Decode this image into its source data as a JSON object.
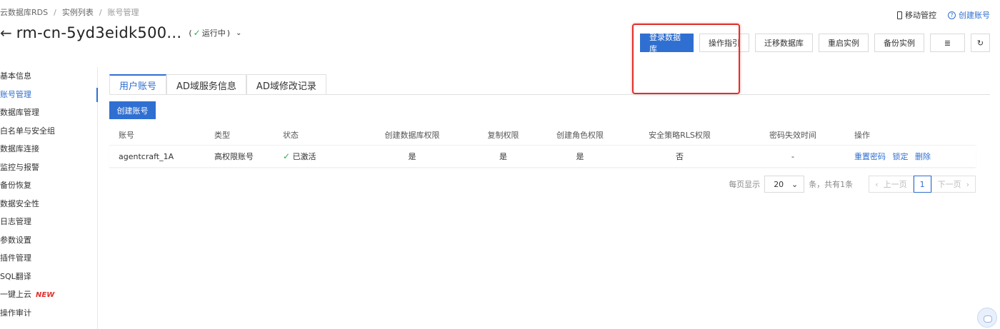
{
  "breadcrumb": {
    "items": [
      "云数据库RDS",
      "实例列表",
      "账号管理"
    ]
  },
  "top_right": {
    "mobile": "移动管控",
    "create_account_link": "创建账号",
    "help_glyph": "?"
  },
  "header": {
    "title": "rm-cn-5yd3eidk500...",
    "status": "运行中",
    "status_prefix": "(",
    "status_suffix": ")",
    "back_glyph": "←",
    "check_glyph": "✓",
    "chevron_glyph": "⌄"
  },
  "actions": {
    "login": "登录数据库",
    "guide": "操作指引",
    "migrate": "迁移数据库",
    "restart": "重启实例",
    "backup": "备份实例",
    "list_icon": "≣",
    "refresh_icon": "↻"
  },
  "sidebar": {
    "items": [
      {
        "label": "基本信息"
      },
      {
        "label": "账号管理"
      },
      {
        "label": "数据库管理"
      },
      {
        "label": "白名单与安全组"
      },
      {
        "label": "数据库连接"
      },
      {
        "label": "监控与报警"
      },
      {
        "label": "备份恢复"
      },
      {
        "label": "数据安全性"
      },
      {
        "label": "日志管理"
      },
      {
        "label": "参数设置"
      },
      {
        "label": "插件管理"
      },
      {
        "label": "SQL翻译"
      },
      {
        "label": "一键上云"
      },
      {
        "label": "操作审计"
      }
    ],
    "new_tag": "NEW"
  },
  "tabs": [
    "用户账号",
    "AD域服务信息",
    "AD域修改记录"
  ],
  "create_button": "创建账号",
  "table": {
    "headers": [
      "账号",
      "类型",
      "状态",
      "创建数据库权限",
      "复制权限",
      "创建角色权限",
      "安全策略RLS权限",
      "密码失效时间",
      "操作"
    ],
    "row": {
      "account": "agentcraft_1A",
      "type": "高权限账号",
      "status": "已激活",
      "create_db": "是",
      "replicate": "是",
      "create_role": "是",
      "rls": "否",
      "pwd_expire": "-",
      "ops": [
        "重置密码",
        "锁定",
        "删除"
      ]
    }
  },
  "pager": {
    "per_page_label": "每页显示",
    "per_page": "20",
    "total": "条，共有1条",
    "prev": "上一页",
    "page": "1",
    "next": "下一页"
  },
  "colors": {
    "accent": "#2f6fd1",
    "highlight": "#e0302b",
    "success": "#2bb24c"
  }
}
